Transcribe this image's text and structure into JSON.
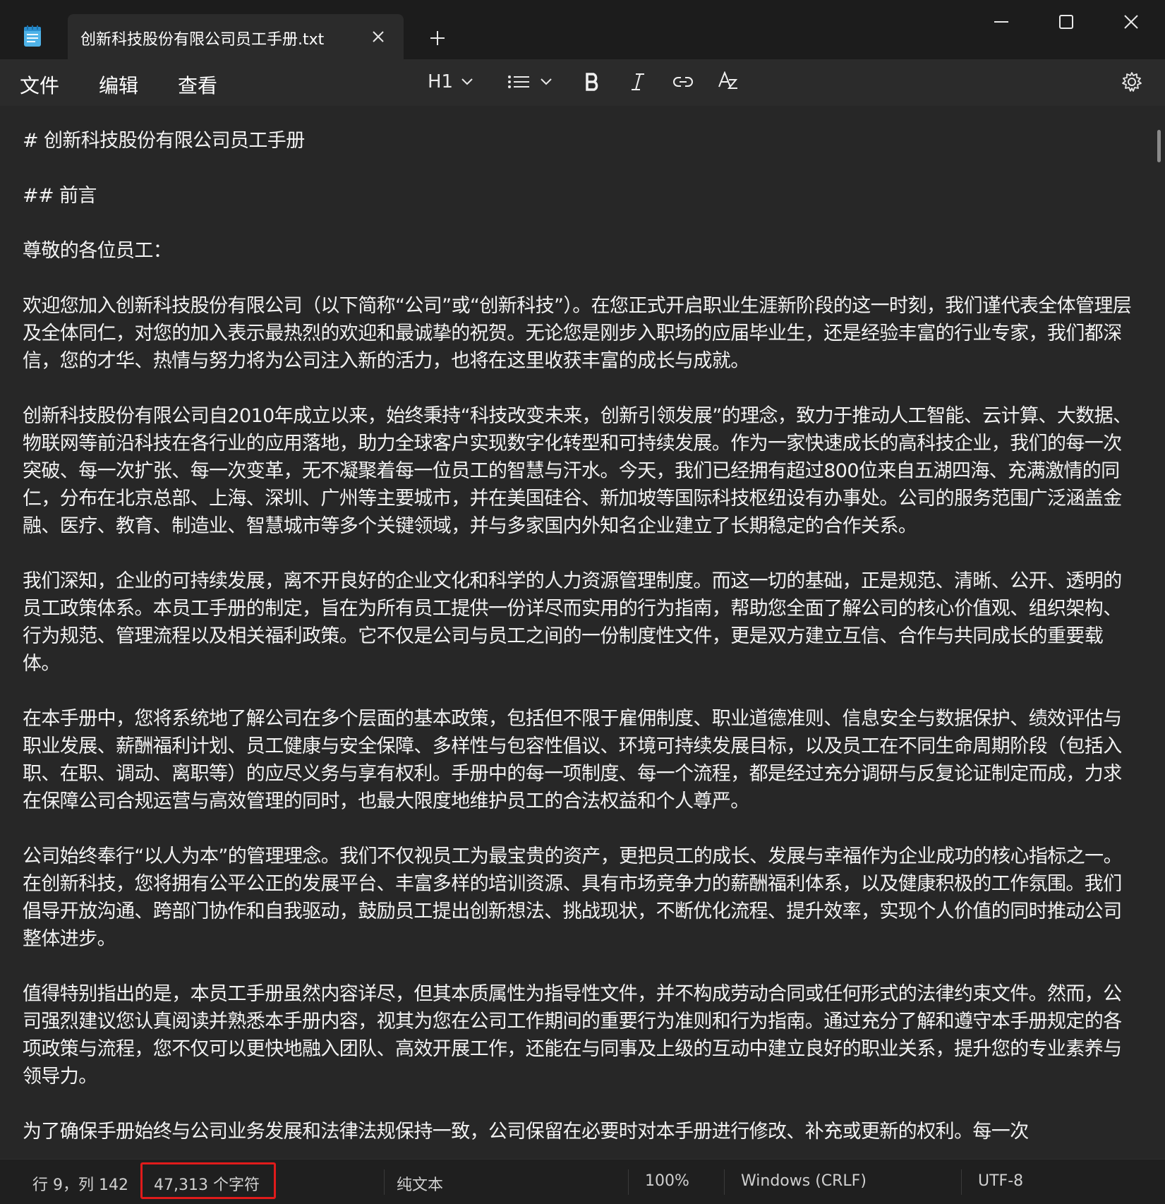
{
  "tab": {
    "title": "创新科技股份有限公司员工手册.txt"
  },
  "menu": {
    "file": "文件",
    "edit": "编辑",
    "view": "查看"
  },
  "toolbar": {
    "heading": "H1",
    "icons": [
      "list-icon",
      "bold-icon",
      "italic-icon",
      "link-icon",
      "spellcheck-icon",
      "settings-icon"
    ]
  },
  "document": {
    "paragraphs": [
      "# 创新科技股份有限公司员工手册",
      "## 前言",
      "尊敬的各位员工：",
      "欢迎您加入创新科技股份有限公司（以下简称“公司”或“创新科技”）。在您正式开启职业生涯新阶段的这一时刻，我们谨代表全体管理层及全体同仁，对您的加入表示最热烈的欢迎和最诚挚的祝贺。无论您是刚步入职场的应届毕业生，还是经验丰富的行业专家，我们都深信，您的才华、热情与努力将为公司注入新的活力，也将在这里收获丰富的成长与成就。",
      "创新科技股份有限公司自2010年成立以来，始终秉持“科技改变未来，创新引领发展”的理念，致力于推动人工智能、云计算、大数据、物联网等前沿科技在各行业的应用落地，助力全球客户实现数字化转型和可持续发展。作为一家快速成长的高科技企业，我们的每一次突破、每一次扩张、每一次变革，无不凝聚着每一位员工的智慧与汗水。今天，我们已经拥有超过800位来自五湖四海、充满激情的同仁，分布在北京总部、上海、深圳、广州等主要城市，并在美国硅谷、新加坡等国际科技枢纽设有办事处。公司的服务范围广泛涵盖金融、医疗、教育、制造业、智慧城市等多个关键领域，并与多家国内外知名企业建立了长期稳定的合作关系。",
      "我们深知，企业的可持续发展，离不开良好的企业文化和科学的人力资源管理制度。而这一切的基础，正是规范、清晰、公开、透明的员工政策体系。本员工手册的制定，旨在为所有员工提供一份详尽而实用的行为指南，帮助您全面了解公司的核心价值观、组织架构、行为规范、管理流程以及相关福利政策。它不仅是公司与员工之间的一份制度性文件，更是双方建立互信、合作与共同成长的重要载体。",
      "在本手册中，您将系统地了解公司在多个层面的基本政策，包括但不限于雇佣制度、职业道德准则、信息安全与数据保护、绩效评估与职业发展、薪酬福利计划、员工健康与安全保障、多样性与包容性倡议、环境可持续发展目标，以及员工在不同生命周期阶段（包括入职、在职、调动、离职等）的应尽义务与享有权利。手册中的每一项制度、每一个流程，都是经过充分调研与反复论证制定而成，力求在保障公司合规运营与高效管理的同时，也最大限度地维护员工的合法权益和个人尊严。",
      "公司始终奉行“以人为本”的管理理念。我们不仅视员工为最宝贵的资产，更把员工的成长、发展与幸福作为企业成功的核心指标之一。在创新科技，您将拥有公平公正的发展平台、丰富多样的培训资源、具有市场竞争力的薪酬福利体系，以及健康积极的工作氛围。我们倡导开放沟通、跨部门协作和自我驱动，鼓励员工提出创新想法、挑战现状，不断优化流程、提升效率，实现个人价值的同时推动公司整体进步。",
      "值得特别指出的是，本员工手册虽然内容详尽，但其本质属性为指导性文件，并不构成劳动合同或任何形式的法律约束文件。然而，公司强烈建议您认真阅读并熟悉本手册内容，视其为您在公司工作期间的重要行为准则和行为指南。通过充分了解和遵守本手册规定的各项政策与流程，您不仅可以更快地融入团队、高效开展工作，还能在与同事及上级的互动中建立良好的职业关系，提升您的专业素养与领导力。",
      "为了确保手册始终与公司业务发展和法律法规保持一致，公司保留在必要时对本手册进行修改、补充或更新的权利。每一次"
    ]
  },
  "status": {
    "position": "行 9，列 142",
    "char_count": "47,313 个字符",
    "format": "纯文本",
    "zoom": "100%",
    "line_ending": "Windows (CRLF)",
    "encoding": "UTF-8"
  },
  "colors": {
    "background": "#202020",
    "editor": "#272727",
    "highlight": "#e01b1b"
  }
}
